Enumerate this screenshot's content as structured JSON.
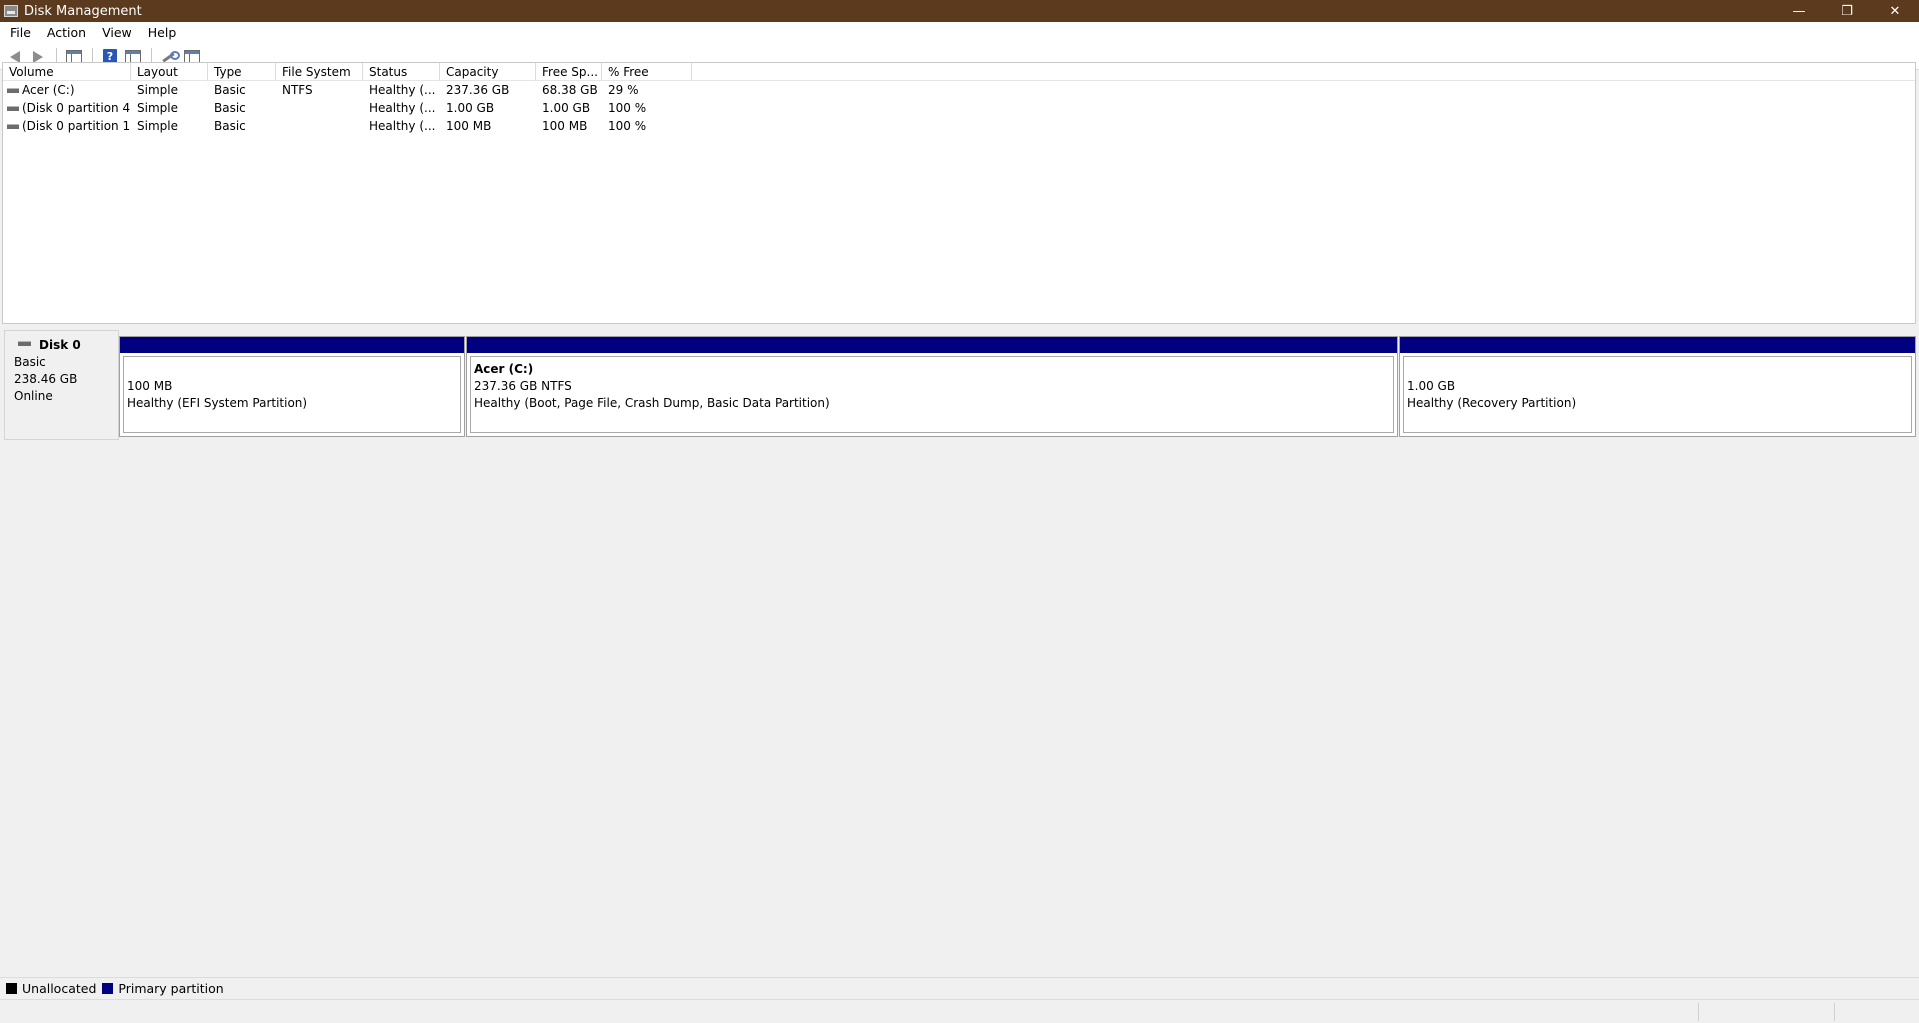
{
  "window": {
    "title": "Disk Management",
    "minimize": "—",
    "restore": "❐",
    "close": "✕"
  },
  "menu": [
    "File",
    "Action",
    "View",
    "Help"
  ],
  "toolbar": {
    "icons": [
      "back-icon",
      "forward-icon",
      "console-tree-icon",
      "help-icon",
      "properties-icon",
      "tools-icon",
      "list-view-icon"
    ],
    "help_glyph": "?"
  },
  "volume_list": {
    "columns": [
      "Volume",
      "Layout",
      "Type",
      "File System",
      "Status",
      "Capacity",
      "Free Sp...",
      "% Free"
    ],
    "rows": [
      {
        "volume": "Acer (C:)",
        "layout": "Simple",
        "type": "Basic",
        "fs": "NTFS",
        "status": "Healthy (...",
        "capacity": "237.36 GB",
        "free": "68.38 GB",
        "pct": "29 %"
      },
      {
        "volume": "(Disk 0 partition 4)",
        "layout": "Simple",
        "type": "Basic",
        "fs": "",
        "status": "Healthy (...",
        "capacity": "1.00 GB",
        "free": "1.00 GB",
        "pct": "100 %"
      },
      {
        "volume": "(Disk 0 partition 1)",
        "layout": "Simple",
        "type": "Basic",
        "fs": "",
        "status": "Healthy (...",
        "capacity": "100 MB",
        "free": "100 MB",
        "pct": "100 %"
      }
    ]
  },
  "disk": {
    "name": "Disk 0",
    "type": "Basic",
    "size": "238.46 GB",
    "state": "Online",
    "partitions": [
      {
        "name": "",
        "size": "100 MB",
        "status": "Healthy (EFI System Partition)"
      },
      {
        "name": "Acer  (C:)",
        "size": "237.36 GB NTFS",
        "status": "Healthy (Boot, Page File, Crash Dump, Basic Data Partition)"
      },
      {
        "name": "",
        "size": "1.00 GB",
        "status": "Healthy (Recovery Partition)"
      }
    ]
  },
  "legend": {
    "unallocated": {
      "label": "Unallocated",
      "color": "#000000"
    },
    "primary": {
      "label": "Primary partition",
      "color": "#000080"
    }
  }
}
